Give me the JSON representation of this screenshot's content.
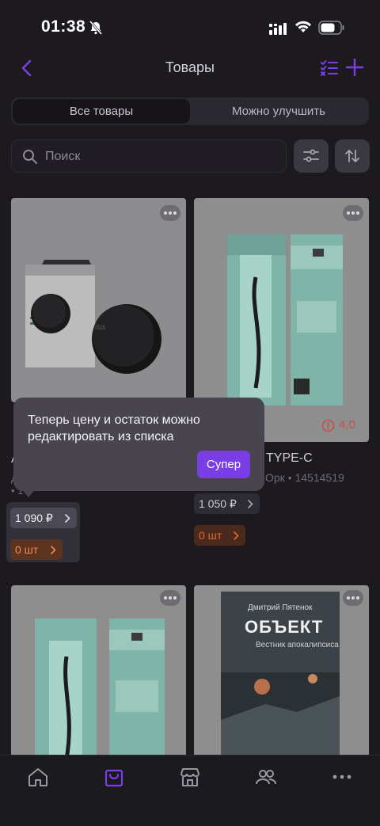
{
  "status_bar": {
    "time": "01:38"
  },
  "nav": {
    "title": "Товары"
  },
  "segments": {
    "all": "Все товары",
    "improve": "Можно улучшить"
  },
  "search": {
    "placeholder": "Поиск"
  },
  "products": [
    {
      "title_visible": "A",
      "meta_visible": "Д",
      "meta_id_visible": "• 1",
      "price": "1 090 ₽",
      "stock": "0 шт"
    },
    {
      "title_visible": "TYPE-C",
      "meta_visible": "Орк • 14514519",
      "price": "1 050 ₽",
      "stock": "0 шт",
      "rating": "4,0"
    },
    {
      "title_visible": ""
    },
    {
      "title_visible": ""
    }
  ],
  "book_cover": {
    "author": "Дмитрий Пятенок",
    "title": "ОБЪЕКТ",
    "subtitle": "Вестник апокалипсиса"
  },
  "tooltip": {
    "text": "Теперь цену и остаток можно редактировать из списка",
    "button": "Супер"
  },
  "tabs": [
    "home-icon",
    "products-icon",
    "store-icon",
    "users-icon",
    "more-icon"
  ],
  "colors": {
    "accent": "#7a3ee6",
    "background": "#1c1a1f",
    "stock_warning": "#e06a2f",
    "rating_alert": "#c8504a"
  }
}
